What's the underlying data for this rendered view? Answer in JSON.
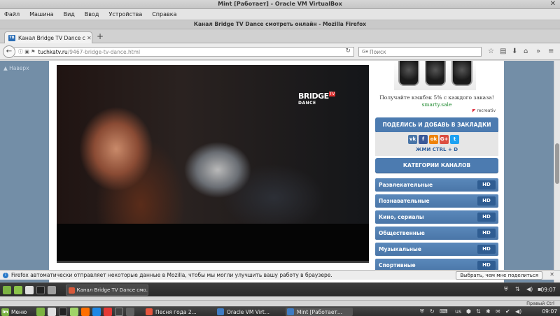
{
  "vbox": {
    "title": "Mint [Работает] - Oracle VM VirtualBox",
    "menu": [
      "Файл",
      "Машина",
      "Вид",
      "Ввод",
      "Устройства",
      "Справка"
    ],
    "status_text": "Правый Ctrl"
  },
  "firefox": {
    "window_title": "Канал Bridge TV Dance смотреть онлайн - Mozilla Firefox",
    "tab_label": "Канал Bridge TV Dance c...",
    "tab_favicon": "TB",
    "url_host": "tuchkatv.ru",
    "url_path": "/9467-bridge-tv-dance.html",
    "search_placeholder": "Поиск",
    "notification_text": "Firefox автоматически отправляет некоторые данные в Mozilla, чтобы мы могли улучшить вашу работу в браузере.",
    "notification_button": "Выбрать, чем мне поделиться"
  },
  "page": {
    "back_to_top": "▲ Наверх",
    "channel_logo_main": "BRIDGE",
    "channel_logo_tv": "TV",
    "channel_logo_sub": "DANCE",
    "ad_text": "Получайте кэшбэк 5% с каждого заказа!",
    "ad_link": "smarty.sale",
    "ad_network": "recreativ",
    "share_header": "ПОДЕЛИСЬ И ДОБАВЬ В ЗАКЛАДКИ",
    "share_hint": "ЖМИ CTRL + D",
    "share_buttons": [
      {
        "label": "vk",
        "color": "#4a76a8"
      },
      {
        "label": "f",
        "color": "#3b5998"
      },
      {
        "label": "ok",
        "color": "#ee8208"
      },
      {
        "label": "G+",
        "color": "#dc4e41"
      },
      {
        "label": "t",
        "color": "#1da1f2"
      }
    ],
    "categories_header": "КАТЕГОРИИ КАНАЛОВ",
    "categories": [
      {
        "label": "Развлекательные",
        "badge": "HD"
      },
      {
        "label": "Познавательные",
        "badge": "HD"
      },
      {
        "label": "Кино, сериалы",
        "badge": "HD"
      },
      {
        "label": "Общественные",
        "badge": "HD"
      },
      {
        "label": "Музыкальные",
        "badge": "HD"
      },
      {
        "label": "Спортивные",
        "badge": "HD"
      }
    ]
  },
  "guest_taskbar": {
    "task_label": "Канал Bridge TV Dance смо...",
    "clock": "09:07"
  },
  "host_taskbar": {
    "menu_label": "Меню",
    "tasks": [
      "Песня года 2...",
      "Oracle VM Virt...",
      "Mint [Работает..."
    ],
    "keyboard_layout": "us",
    "clock": "09:07"
  },
  "colors": {
    "accent": "#4c7bb0",
    "page_background": "#738ea7",
    "ad_link": "#1f8a2f"
  }
}
